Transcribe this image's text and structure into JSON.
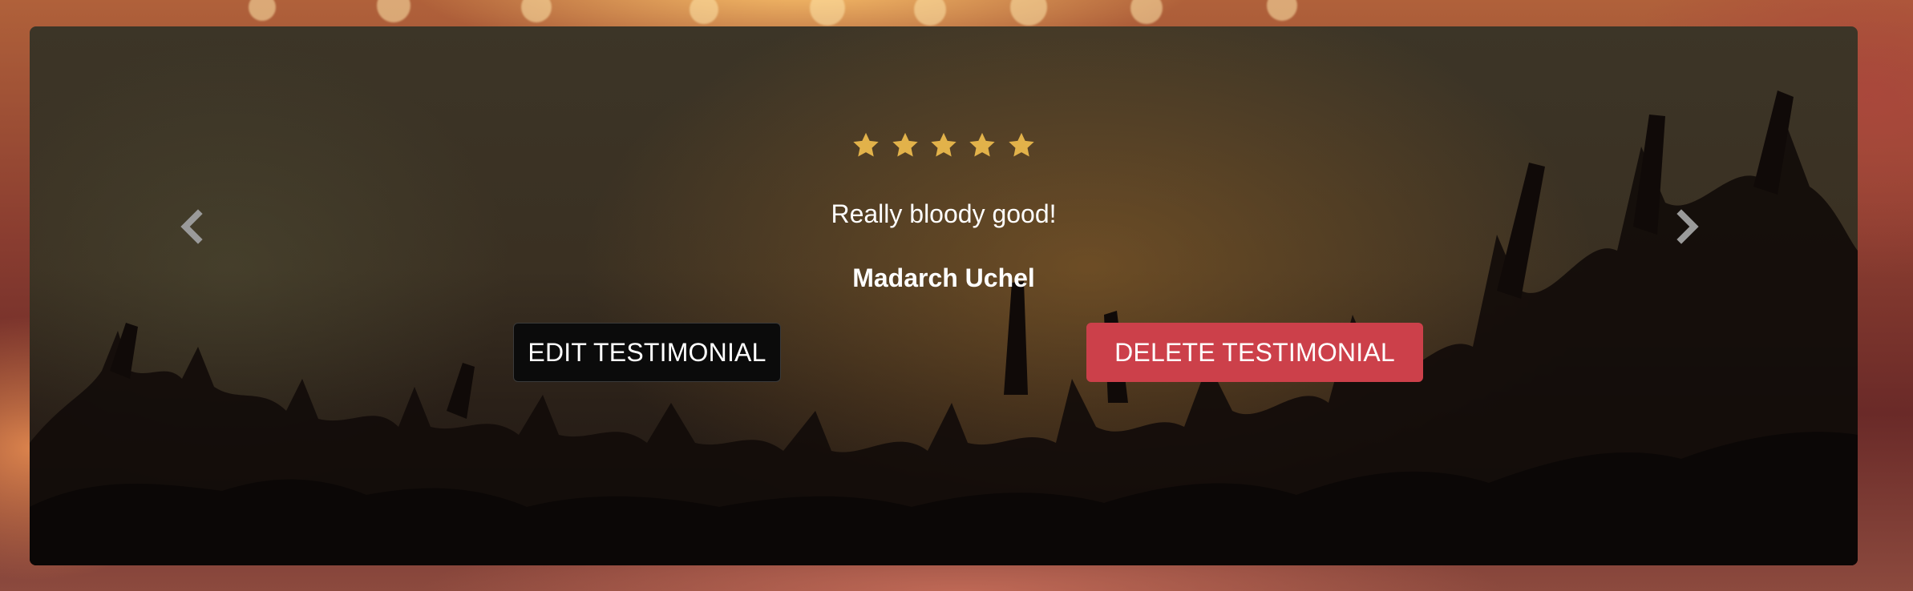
{
  "testimonial": {
    "rating": 5,
    "max_rating": 5,
    "text": "Really bloody good!",
    "author": "Madarch Uchel"
  },
  "actions": {
    "edit_label": "EDIT TESTIMONIAL",
    "delete_label": "DELETE TESTIMONIAL"
  },
  "icons": {
    "prev": "chevron-left-icon",
    "next": "chevron-right-icon",
    "star": "star-icon"
  },
  "colors": {
    "star": "#e2b24a",
    "delete_button": "#cc404a",
    "edit_button": "#0b0b0b",
    "text": "#ffffff"
  }
}
